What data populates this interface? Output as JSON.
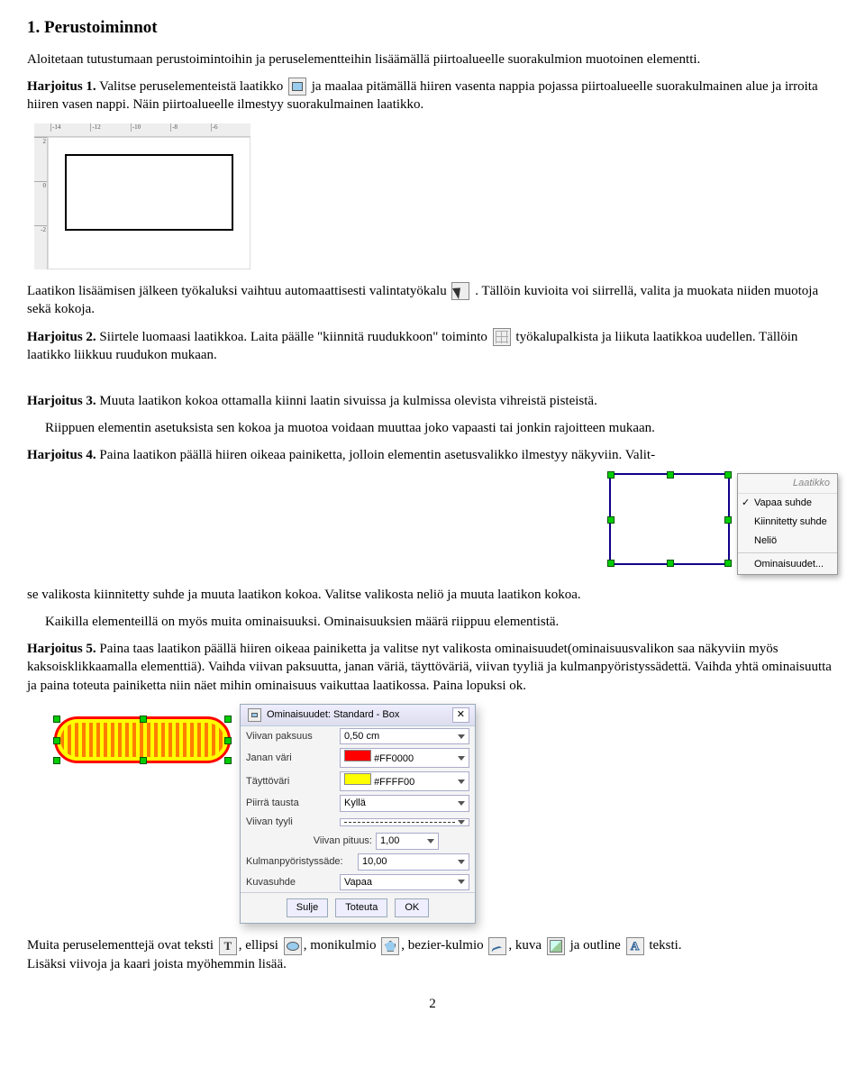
{
  "h1": "1. Perustoiminnot",
  "intro": "Aloitetaan tutustumaan perustoimintoihin ja peruselementteihin lisäämällä piirtoalueelle suorakulmion muotoinen elementti.",
  "ex1": {
    "label": "Harjoitus 1.",
    "before_icon": "Valitse peruselementeistä laatikko",
    "after_icon": " ja maalaa pitämällä hiiren vasenta nappia pojassa piirtoalueelle suorakulmainen alue ja irroita hiiren vasen nappi. Näin piirtoalueelle ilmestyy suorakulmainen laatikko."
  },
  "ruler_ticks_h": [
    "-14",
    "-12",
    "-10",
    "-8",
    "-6"
  ],
  "ruler_ticks_v": [
    "2",
    "0",
    "-2"
  ],
  "after_fig1": {
    "before_icon": "Laatikon lisäämisen jälkeen työkaluksi vaihtuu automaattisesti valintatyökalu ",
    "after_icon": ". Tällöin kuvioita voi siirrellä, valita ja muokata niiden muotoja sekä kokoja."
  },
  "ex2": {
    "label": "Harjoitus 2.",
    "before_icon": "Siirtele luomaasi laatikkoa. Laita päälle \"kiinnitä ruudukkoon\" toiminto",
    "after_icon": " työkalupalkista ja liikuta laatikkoa uudellen. Tällöin laatikko liikkuu ruudukon mukaan."
  },
  "ex3": {
    "label": "Harjoitus 3.",
    "text": "Muuta laatikon kokoa ottamalla kiinni laatin sivuissa ja kulmissa olevista vihreistä pisteistä."
  },
  "ex3_para2": "Riippuen elementin asetuksista sen kokoa ja muotoa voidaan muuttaa joko vapaasti tai jonkin rajoitteen mukaan.",
  "ex4": {
    "label": "Harjoitus 4.",
    "text": "Paina laatikon päällä hiiren oikeaa painiketta, jolloin elementin asetusvalikko ilmestyy näkyviin. Valit-"
  },
  "context_menu": {
    "title": "Laatikko",
    "items": [
      {
        "label": "Vapaa suhde",
        "checked": true
      },
      {
        "label": "Kiinnitetty suhde",
        "checked": false
      },
      {
        "label": "Neliö",
        "checked": false
      }
    ],
    "last": "Ominaisuudet..."
  },
  "after_fig2": "se valikosta kiinnitetty suhde ja muuta laatikon kokoa. Valitse valikosta neliö ja muuta laatikon kokoa.",
  "para_kaikilla": "Kaikilla elementeillä on myös muita ominaisuuksi. Ominaisuuksien määrä riippuu elementistä.",
  "ex5": {
    "label": "Harjoitus 5.",
    "text": "Paina taas laatikon päällä hiiren oikeaa painiketta ja valitse nyt valikosta ominaisuudet(ominaisuusvalikon saa näkyviin myös kaksoisklikkaamalla elementtiä). Vaihda viivan paksuutta, janan väriä, täyttöväriä, viivan tyyliä ja kulmanpyöristyssädettä. Vaihda yhtä ominaisuutta ja paina toteuta painiketta niin näet mihin ominaisuus vaikuttaa laatikossa. Paina lopuksi ok."
  },
  "dialog": {
    "title": "Ominaisuudet: Standard - Box",
    "rows": {
      "viivan_paksuus": {
        "label": "Viivan paksuus",
        "value": "0,50 cm"
      },
      "janan_vari": {
        "label": "Janan väri",
        "value": "#FF0000"
      },
      "tayttovari": {
        "label": "Täyttöväri",
        "value": "#FFFF00"
      },
      "piirra_tausta": {
        "label": "Piirrä tausta",
        "value": "Kyllä"
      },
      "viivan_tyyli": {
        "label": "Viivan tyyli",
        "value": ""
      },
      "viivan_pituus": {
        "label": "Viivan pituus:",
        "value": "1,00"
      },
      "kulmanpyoristys": {
        "label": "Kulmanpyöristyssäde:",
        "value": "10,00"
      },
      "kuvasuhde": {
        "label": "Kuvasuhde",
        "value": "Vapaa"
      }
    },
    "buttons": {
      "sulje": "Sulje",
      "toteuta": "Toteuta",
      "ok": "OK"
    }
  },
  "last_para": {
    "lead": "Muita peruselementtejä ovat",
    "parts": {
      "teksti": " teksti ",
      "ellipsi": ", ellipsi ",
      "monikulmio": ", monikulmio ",
      "bezier": ", bezier-kulmio ",
      "kuva": ", kuva ",
      "outline": " ja outline ",
      "tail": " teksti."
    },
    "line2": "Lisäksi viivoja ja kaari joista myöhemmin lisää."
  },
  "page_number": "2"
}
